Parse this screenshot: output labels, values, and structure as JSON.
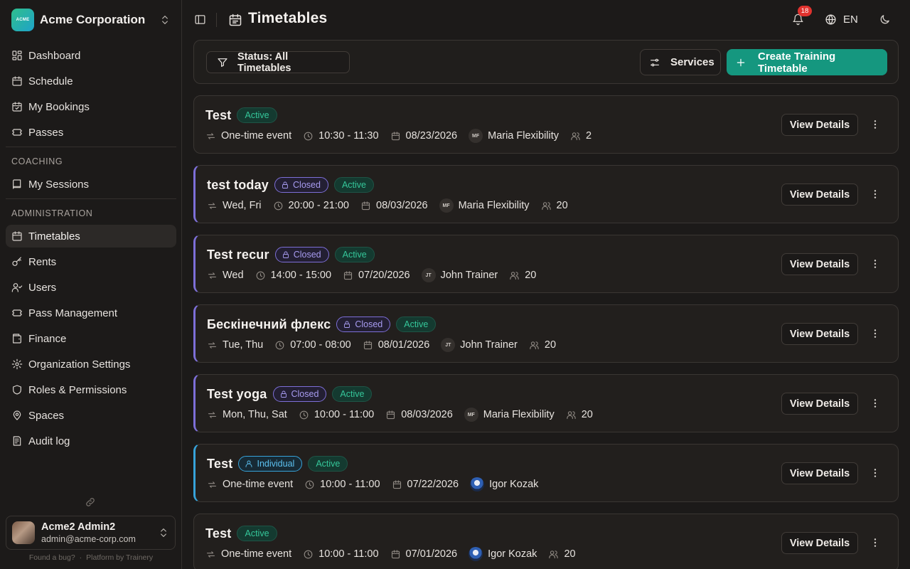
{
  "org": {
    "logo_text": "ACME",
    "name": "Acme Corporation"
  },
  "nav": {
    "main": [
      {
        "label": "Dashboard",
        "icon": "dashboard-icon"
      },
      {
        "label": "Schedule",
        "icon": "calendar-icon"
      },
      {
        "label": "My Bookings",
        "icon": "calendar-check-icon"
      },
      {
        "label": "Passes",
        "icon": "ticket-icon"
      }
    ],
    "coaching_label": "COACHING",
    "coaching": [
      {
        "label": "My Sessions",
        "icon": "book-icon"
      }
    ],
    "admin_label": "ADMINISTRATION",
    "admin": [
      {
        "label": "Timetables",
        "icon": "calendar-icon",
        "active": true
      },
      {
        "label": "Rents",
        "icon": "key-icon"
      },
      {
        "label": "Users",
        "icon": "users-icon"
      },
      {
        "label": "Pass Management",
        "icon": "ticket-icon"
      },
      {
        "label": "Finance",
        "icon": "wallet-icon"
      },
      {
        "label": "Organization Settings",
        "icon": "settings-icon"
      },
      {
        "label": "Roles & Permissions",
        "icon": "shield-icon"
      },
      {
        "label": "Spaces",
        "icon": "map-pin-icon"
      },
      {
        "label": "Audit log",
        "icon": "audit-icon"
      }
    ]
  },
  "user": {
    "name": "Acme2 Admin2",
    "email": "admin@acme-corp.com"
  },
  "footer": {
    "bug": "Found a bug?",
    "separator": "·",
    "platform": "Platform by Trainery"
  },
  "header": {
    "title": "Timetables",
    "notifications": "18",
    "language": "EN"
  },
  "toolbar": {
    "status_filter": "Status: All Timetables",
    "services": "Services",
    "create": "Create Training Timetable"
  },
  "cards": [
    {
      "title": "Test",
      "accent": "",
      "badges": [
        {
          "type": "active",
          "label": "Active"
        }
      ],
      "recurrence": "One-time event",
      "time": "10:30 - 11:30",
      "date": "08/23/2026",
      "trainer_initials": "MF",
      "trainer": "Maria Flexibility",
      "capacity": "2",
      "view": "View Details"
    },
    {
      "title": "test today",
      "accent": "purple",
      "badges": [
        {
          "type": "closed",
          "label": "Closed"
        },
        {
          "type": "active",
          "label": "Active"
        }
      ],
      "recurrence": "Wed, Fri",
      "time": "20:00 - 21:00",
      "date": "08/03/2026",
      "trainer_initials": "MF",
      "trainer": "Maria Flexibility",
      "capacity": "20",
      "view": "View Details"
    },
    {
      "title": "Test recur",
      "accent": "purple",
      "badges": [
        {
          "type": "closed",
          "label": "Closed"
        },
        {
          "type": "active",
          "label": "Active"
        }
      ],
      "recurrence": "Wed",
      "time": "14:00 - 15:00",
      "date": "07/20/2026",
      "trainer_initials": "JT",
      "trainer": "John Trainer",
      "capacity": "20",
      "view": "View Details"
    },
    {
      "title": "Бескінечний флекс",
      "accent": "purple",
      "badges": [
        {
          "type": "closed",
          "label": "Closed"
        },
        {
          "type": "active",
          "label": "Active"
        }
      ],
      "recurrence": "Tue, Thu",
      "time": "07:00 - 08:00",
      "date": "08/01/2026",
      "trainer_initials": "JT",
      "trainer": "John Trainer",
      "capacity": "20",
      "view": "View Details"
    },
    {
      "title": "Test yoga",
      "accent": "purple",
      "badges": [
        {
          "type": "closed",
          "label": "Closed"
        },
        {
          "type": "active",
          "label": "Active"
        }
      ],
      "recurrence": "Mon, Thu, Sat",
      "time": "10:00 - 11:00",
      "date": "08/03/2026",
      "trainer_initials": "MF",
      "trainer": "Maria Flexibility",
      "capacity": "20",
      "view": "View Details"
    },
    {
      "title": "Test",
      "accent": "blue",
      "badges": [
        {
          "type": "indiv",
          "label": "Individual"
        },
        {
          "type": "active",
          "label": "Active"
        }
      ],
      "recurrence": "One-time event",
      "time": "10:00 - 11:00",
      "date": "07/22/2026",
      "trainer_initials": "",
      "trainer": "Igor Kozak",
      "capacity": "",
      "view": "View Details"
    },
    {
      "title": "Test",
      "accent": "",
      "badges": [
        {
          "type": "active",
          "label": "Active"
        }
      ],
      "recurrence": "One-time event",
      "time": "10:00 - 11:00",
      "date": "07/01/2026",
      "trainer_initials": "",
      "trainer": "Igor Kozak",
      "capacity": "20",
      "view": "View Details"
    }
  ],
  "colors": {
    "accent": "#15977f",
    "closed": "#7d6fd8",
    "individual": "#37a3da",
    "active": "#35c79a",
    "badge": "#e0322e"
  }
}
